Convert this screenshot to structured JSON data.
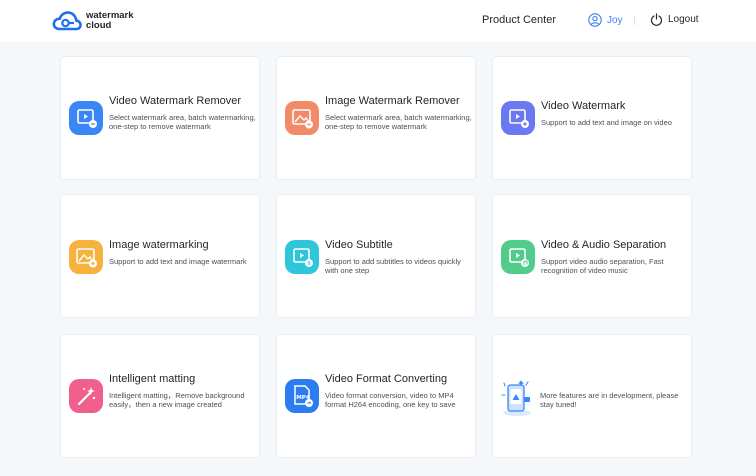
{
  "brand": {
    "line1": "watermark",
    "line2": "cloud"
  },
  "nav": {
    "product_center": "Product Center",
    "user": "Joy",
    "logout": "Logout"
  },
  "cards": [
    {
      "title": "Video Watermark Remover",
      "desc": "Select watermark area, batch watermarking, one-step to remove watermark",
      "icon": "video-remove-icon",
      "color": "#3a86f7"
    },
    {
      "title": "Image Watermark Remover",
      "desc": "Select watermark area, batch watermarking, one-step to remove watermark",
      "icon": "image-remove-icon",
      "color": "#f28a68"
    },
    {
      "title": "Video Watermark",
      "desc": "Support to add text and image on video",
      "icon": "video-watermark-icon",
      "color": "#6a78f2"
    },
    {
      "title": "Image watermarking",
      "desc": "Support to add text and image watermark",
      "icon": "image-watermark-icon",
      "color": "#f6b23d"
    },
    {
      "title": "Video Subtitle",
      "desc": "Support to add subtitles to videos quickly with one step",
      "icon": "subtitle-icon",
      "color": "#2fc6dc"
    },
    {
      "title": "Video & Audio Separation",
      "desc": "Support video audio separation, Fast recognition of video music",
      "icon": "audio-separation-icon",
      "color": "#52cc8a"
    },
    {
      "title": "Intelligent matting",
      "desc": "Intelligent matting，Remove background easily，then a new image created",
      "icon": "matting-wand-icon",
      "color": "#f0608c"
    },
    {
      "title": "Video Format Converting",
      "desc": "Video format conversion, video to MP4 format H264 encoding, one key to save",
      "icon": "mp4-file-icon",
      "color": "#2e7cf2"
    }
  ],
  "more": {
    "text": "More features are in development, please stay tuned!",
    "icon": "phone-development-icon"
  }
}
